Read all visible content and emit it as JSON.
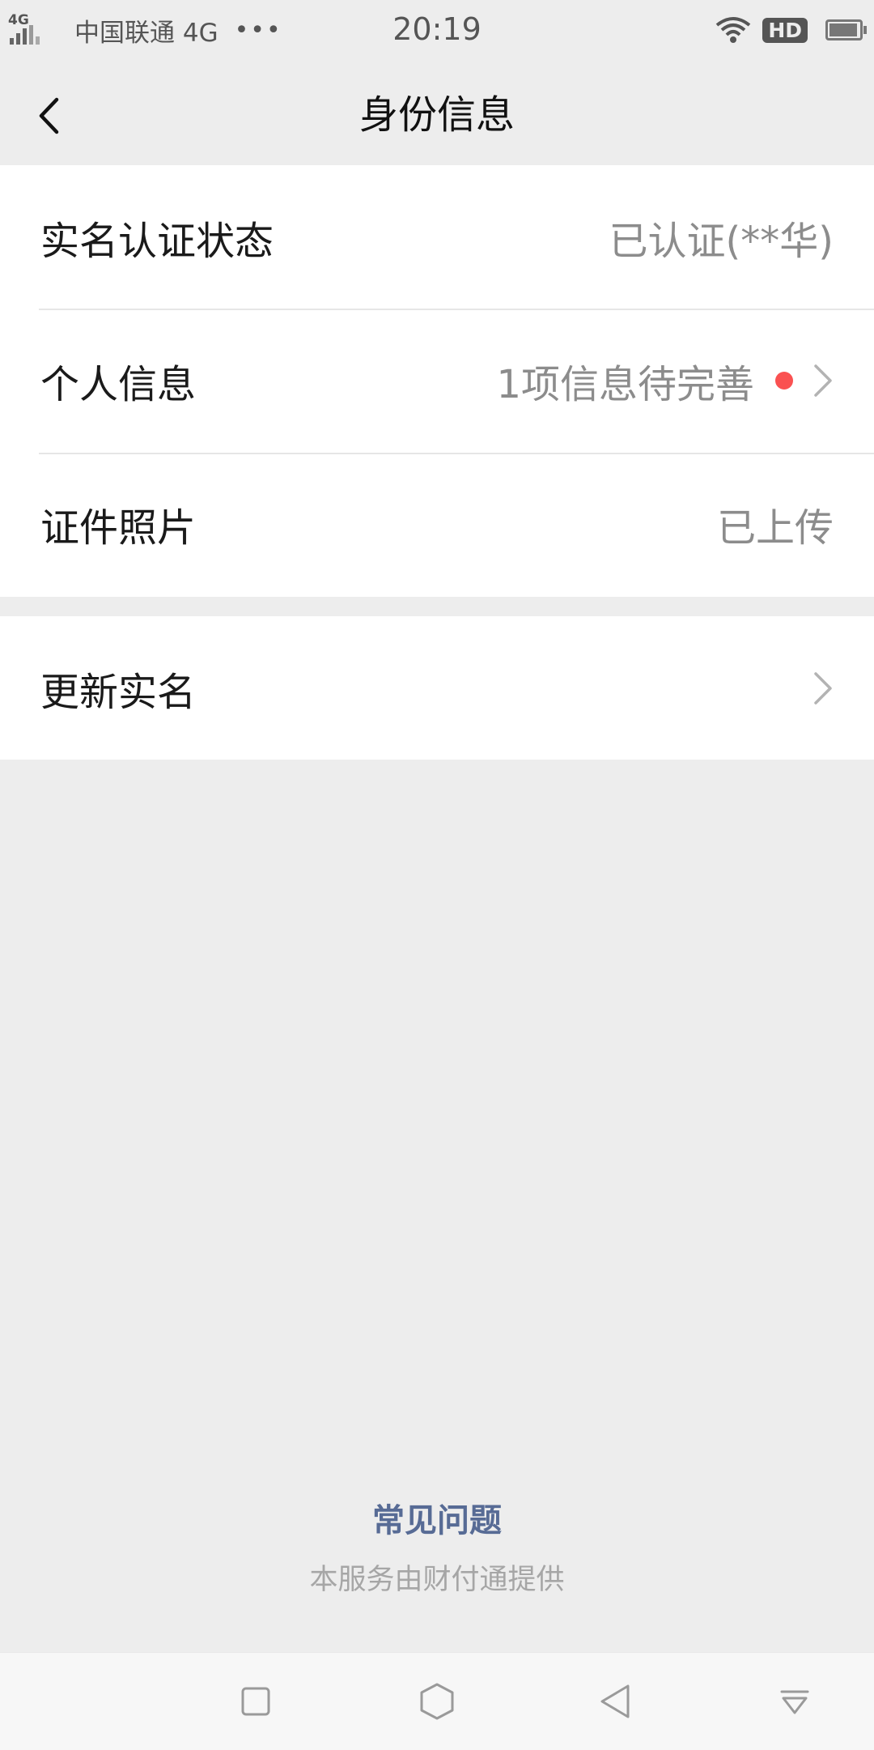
{
  "status_bar": {
    "network_type": "4G",
    "carrier": "中国联通 4G",
    "more": "•••",
    "time": "20:19",
    "hd_badge": "HD"
  },
  "nav": {
    "title": "身份信息"
  },
  "identity_rows": [
    {
      "label": "实名认证状态",
      "value": "已认证(**华)"
    },
    {
      "label": "个人信息",
      "value": "1项信息待完善"
    },
    {
      "label": "证件照片",
      "value": "已上传"
    }
  ],
  "update_row": {
    "label": "更新实名"
  },
  "footer": {
    "faq_label": "常见问题",
    "provider_text": "本服务由财付通提供"
  },
  "colors": {
    "link": "#576b95",
    "alert_dot": "#fa5151",
    "page_background": "#ededed"
  }
}
